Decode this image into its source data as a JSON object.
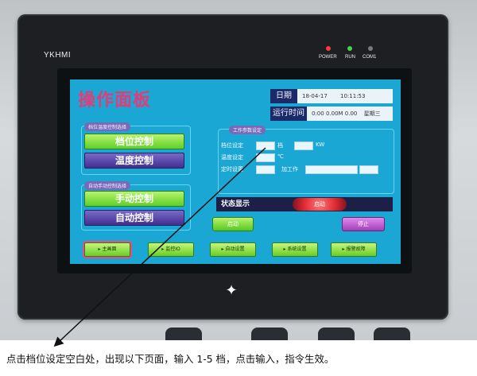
{
  "device": {
    "brand": "YKHMI",
    "indicators": [
      {
        "label": "POWER",
        "color": "#ff3b3b"
      },
      {
        "label": "RUN",
        "color": "#3ddb3d"
      },
      {
        "label": "COM1",
        "color": "#7a7a7a"
      }
    ],
    "home_icon": "home-key-icon"
  },
  "hmi": {
    "title": "操作面板",
    "date_label": "日期",
    "date_value": "18-04-17",
    "time_value": "10:11:53",
    "runtime_label": "运行时间",
    "runtime_value": "0:00 0.00M 0.00",
    "weekday": "星期三",
    "group1_label": "档位温度控制选择",
    "gear_control": "档位控制",
    "temp_control": "温度控制",
    "group2_label": "自动手动控制选择",
    "manual_control": "手动控制",
    "auto_control": "自动控制",
    "param_group_label": "工作参数设定",
    "gear_setting_label": "档位设定",
    "gear_unit": "档",
    "power_unit": "KW",
    "temp_setting_label": "温度设定",
    "temp_unit": "℃",
    "timer_setting_label": "定时设置",
    "work_label": "加工作",
    "status_label": "状态显示",
    "status_value": "启动",
    "start_button": "启动",
    "stop_button": "停止",
    "nav": [
      "主画面",
      "监控IO",
      "自动设置",
      "系统设置",
      "报警故障"
    ]
  },
  "caption": "点击档位设定空白处，出现以下页面，输入 1-5 档，点击输入，指令生效。"
}
